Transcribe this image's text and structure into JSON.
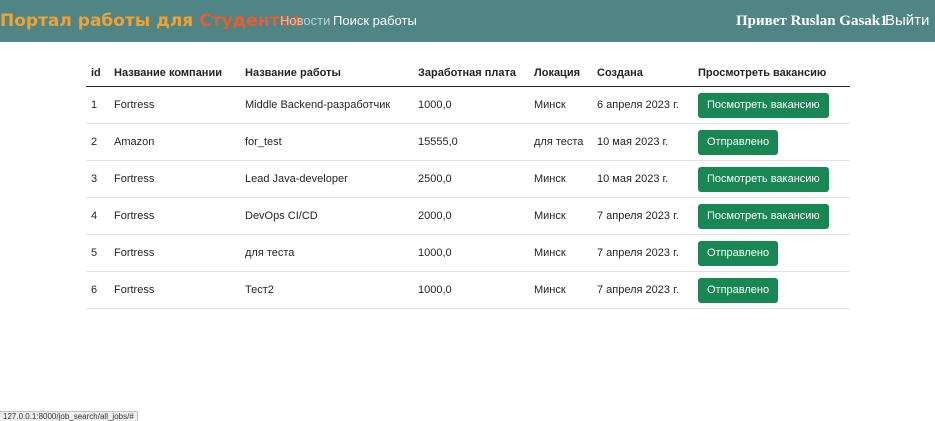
{
  "navbar": {
    "brand_part1": "Портал работы для ",
    "brand_part2": "Студентов",
    "links": {
      "news": "Новости",
      "search": "Поиск работы"
    },
    "greeting": "Привет Ruslan Gasak1",
    "logout": "Выйти"
  },
  "table": {
    "headers": {
      "id": "id",
      "company": "Название компании",
      "job": "Название работы",
      "salary": "Заработная плата",
      "location": "Локация",
      "created": "Создана",
      "action": "Просмотреть вакансию"
    },
    "rows": [
      {
        "id": "1",
        "company": "Fortress",
        "job": "Middle Backend-разработчик",
        "salary": "1000,0",
        "location": "Минск",
        "created": "6 апреля 2023 г.",
        "action": "Посмотреть вакансию"
      },
      {
        "id": "2",
        "company": "Amazon",
        "job": "for_test",
        "salary": "15555,0",
        "location": "для теста",
        "created": "10 мая 2023 г.",
        "action": "Отправлено"
      },
      {
        "id": "3",
        "company": "Fortress",
        "job": "Lead Java-developer",
        "salary": "2500,0",
        "location": "Минск",
        "created": "10 мая 2023 г.",
        "action": "Посмотреть вакансию"
      },
      {
        "id": "4",
        "company": "Fortress",
        "job": "DevOps CI/CD",
        "salary": "2000,0",
        "location": "Минск",
        "created": "7 апреля 2023 г.",
        "action": "Посмотреть вакансию"
      },
      {
        "id": "5",
        "company": "Fortress",
        "job": "для теста",
        "salary": "1000,0",
        "location": "Минск",
        "created": "7 апреля 2023 г.",
        "action": "Отправлено"
      },
      {
        "id": "6",
        "company": "Fortress",
        "job": "Тест2",
        "salary": "1000,0",
        "location": "Минск",
        "created": "7 апреля 2023 г.",
        "action": "Отправлено"
      }
    ]
  },
  "statusbar": {
    "url": "127.0.0.1:8000/job_search/all_jobs/#"
  },
  "colors": {
    "navbar_bg": "#4f8585",
    "brand_orange": "#f2a133",
    "brand_red": "#ec5a2e",
    "button_green": "#198754"
  }
}
